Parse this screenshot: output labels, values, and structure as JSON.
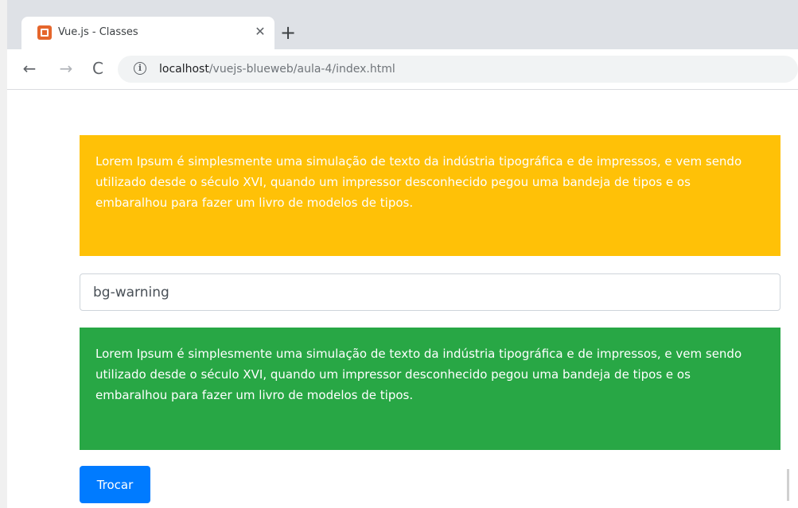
{
  "browser": {
    "tab": {
      "title": "Vue.js - Classes",
      "close_glyph": "✕"
    },
    "new_tab_glyph": "+",
    "nav": {
      "back": "←",
      "forward": "→",
      "reload": "C"
    },
    "address": {
      "info_glyph": "i",
      "host": "localhost",
      "path": "/vuejs-blueweb/aula-4/index.html"
    }
  },
  "page": {
    "warning_box": {
      "text": "Lorem Ipsum é simplesmente uma simulação de texto da indústria tipográfica e de impressos, e vem sendo utilizado desde o século XVI, quando um impressor desconhecido pegou uma bandeja de tipos e os embaralhou para fazer um livro de modelos de tipos.",
      "color": "#ffc107"
    },
    "class_input": {
      "value": "bg-warning"
    },
    "success_box": {
      "text": "Lorem Ipsum é simplesmente uma simulação de texto da indústria tipográfica e de impressos, e vem sendo utilizado desde o século XVI, quando um impressor desconhecido pegou uma bandeja de tipos e os embaralhou para fazer um livro de modelos de tipos.",
      "color": "#28a745"
    },
    "swap_button": {
      "label": "Trocar",
      "color": "#007bff"
    }
  }
}
